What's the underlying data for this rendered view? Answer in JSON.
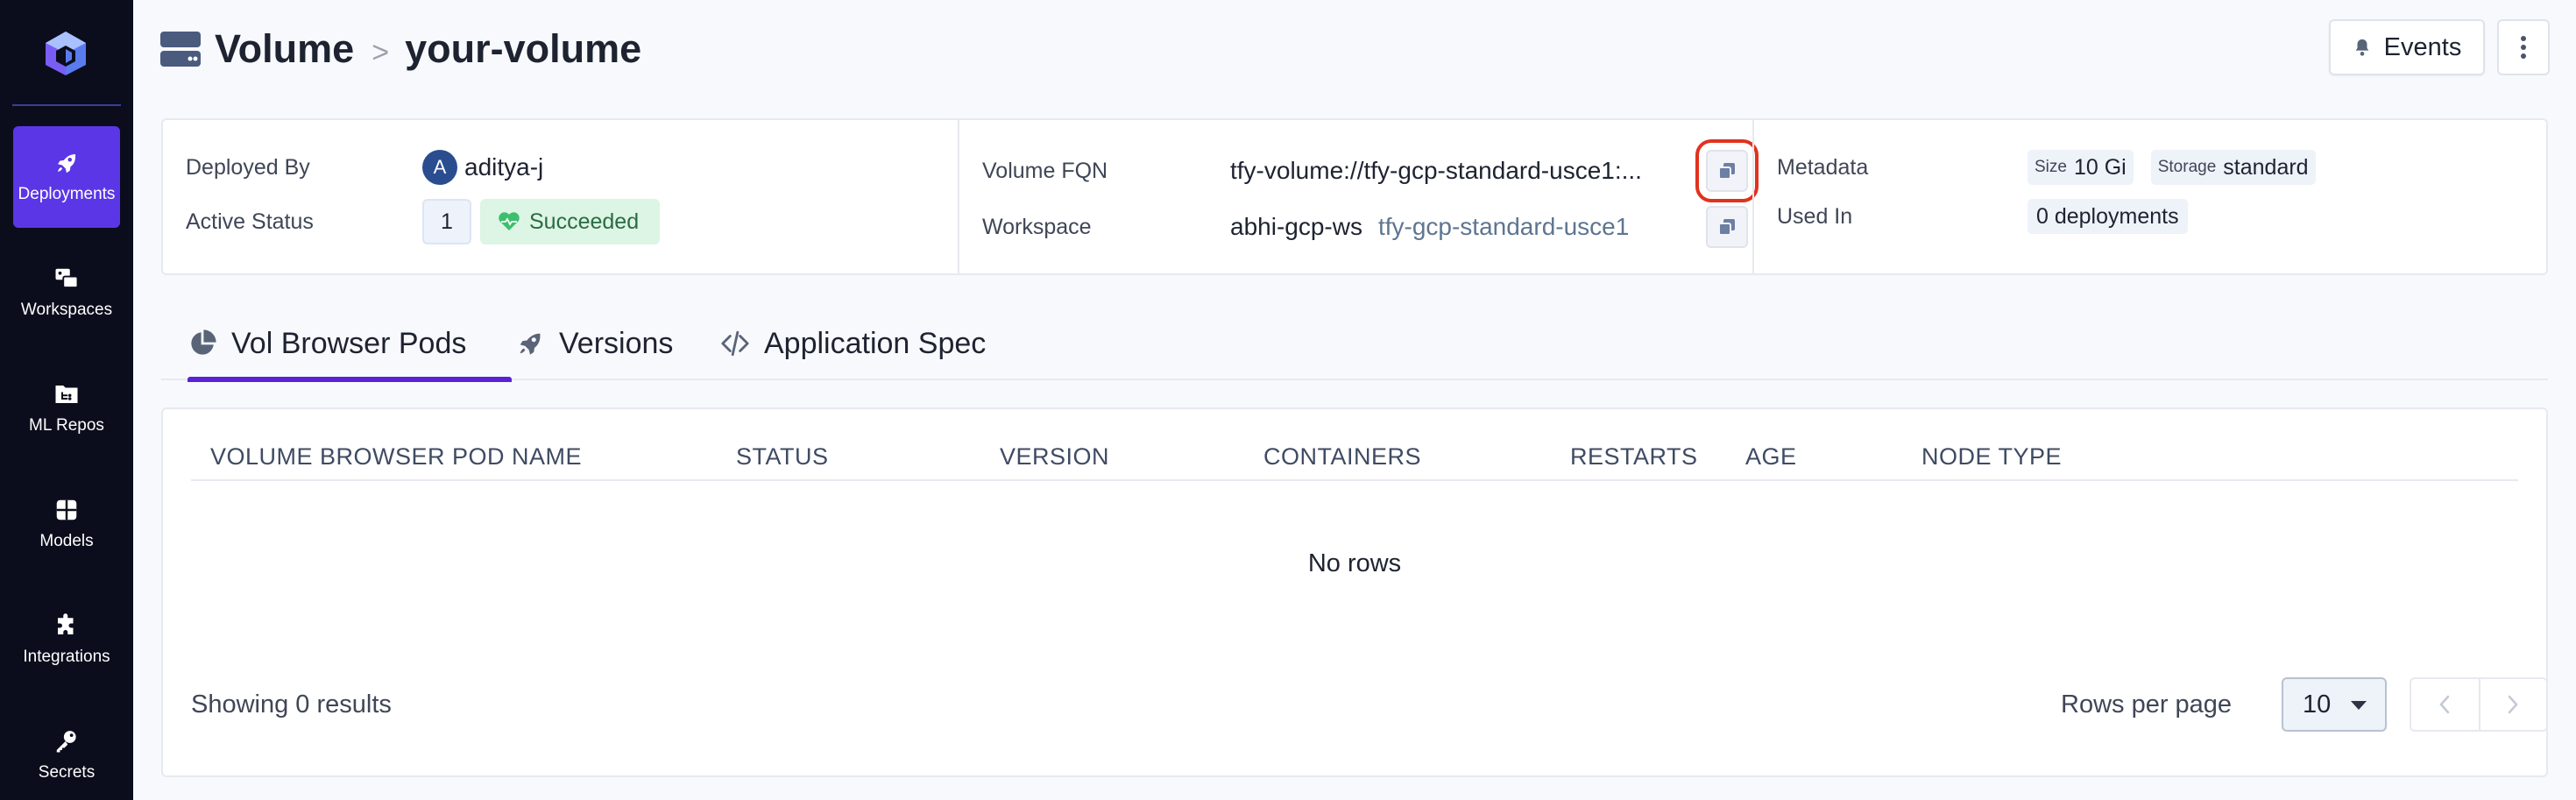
{
  "sidebar": {
    "items": [
      {
        "label": "Deployments",
        "icon": "rocket-icon",
        "active": true
      },
      {
        "label": "Workspaces",
        "icon": "workspaces-icon",
        "active": false
      },
      {
        "label": "ML Repos",
        "icon": "folder-tree-icon",
        "active": false
      },
      {
        "label": "Models",
        "icon": "grid-icon",
        "active": false
      },
      {
        "label": "Integrations",
        "icon": "puzzle-icon",
        "active": false
      },
      {
        "label": "Secrets",
        "icon": "key-icon",
        "active": false
      }
    ]
  },
  "header": {
    "title": "Volume",
    "separator": ">",
    "subtitle": "your-volume",
    "events_label": "Events"
  },
  "info": {
    "deployed_by_label": "Deployed By",
    "deployed_by_initial": "A",
    "deployed_by": "aditya-j",
    "active_status_label": "Active Status",
    "active_count": "1",
    "status": "Succeeded",
    "volume_fqn_label": "Volume FQN",
    "volume_fqn": "tfy-volume://tfy-gcp-standard-usce1:...",
    "workspace_label": "Workspace",
    "workspace_name": "abhi-gcp-ws",
    "workspace_cluster": "tfy-gcp-standard-usce1",
    "metadata_label": "Metadata",
    "metadata": [
      {
        "key": "Size",
        "value": "10 Gi"
      },
      {
        "key": "Storage",
        "value": "standard"
      }
    ],
    "used_in_label": "Used In",
    "used_in": "0 deployments"
  },
  "tabs": [
    {
      "label": "Vol Browser Pods",
      "icon": "pie-chart-icon",
      "active": true
    },
    {
      "label": "Versions",
      "icon": "rocket-icon",
      "active": false
    },
    {
      "label": "Application Spec",
      "icon": "code-icon",
      "active": false
    }
  ],
  "table": {
    "columns": [
      "Volume Browser Pod Name",
      "Status",
      "Version",
      "Containers",
      "Restarts",
      "Age",
      "Node Type"
    ],
    "empty_text": "No rows",
    "showing_text": "Showing 0 results",
    "rows_per_page_label": "Rows per page",
    "rows_per_page_value": "10"
  },
  "colors": {
    "sidebar_bg": "#0b0d1c",
    "active_nav": "#5b36e6",
    "tab_indicator": "#5b21d6",
    "status_bg": "#dcf5e4",
    "highlight": "#e0321f"
  }
}
